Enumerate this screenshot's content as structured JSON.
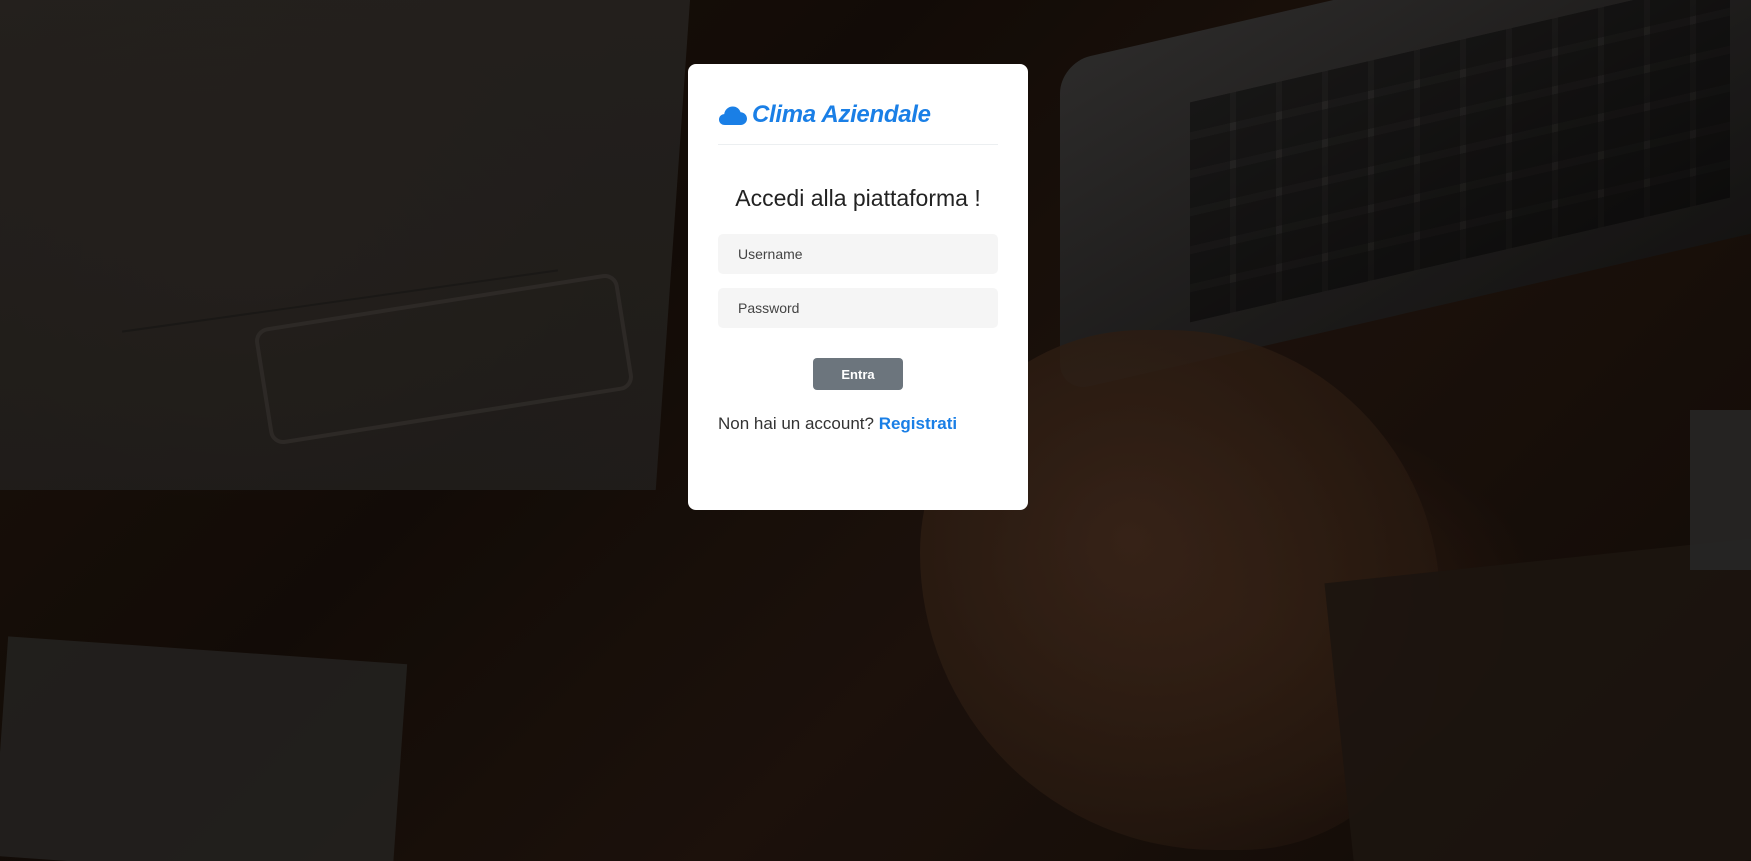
{
  "brand": {
    "name": "Clima Aziendale",
    "icon": "cloud-icon",
    "color": "#1a7fe6"
  },
  "login": {
    "title": "Accedi alla piattaforma !",
    "username_placeholder": "Username",
    "password_placeholder": "Password",
    "submit_label": "Entra",
    "signup_prompt": "Non hai un account?",
    "signup_link": "Registrati"
  },
  "colors": {
    "accent": "#1a7fe6",
    "button": "#6c757d",
    "input_bg": "#f5f5f5"
  }
}
